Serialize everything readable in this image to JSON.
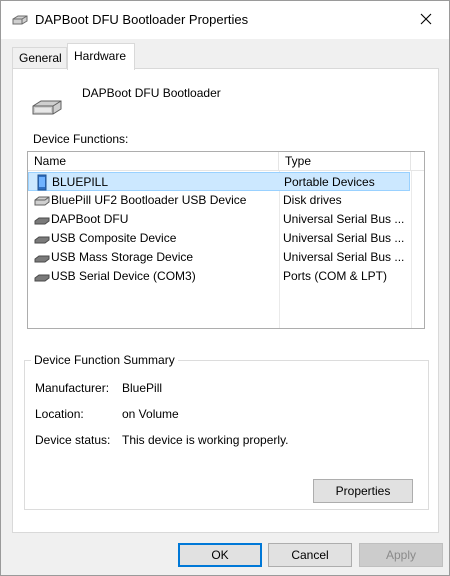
{
  "window": {
    "title": "DAPBoot DFU Bootloader Properties"
  },
  "tabs": [
    {
      "label": "General",
      "active": false
    },
    {
      "label": "Hardware",
      "active": true
    }
  ],
  "device": {
    "name": "DAPBoot DFU Bootloader"
  },
  "functions": {
    "label": "Device Functions:",
    "columns": {
      "name": "Name",
      "type": "Type"
    },
    "rows": [
      {
        "icon": "portable-device-icon",
        "name": "BLUEPILL",
        "type": "Portable Devices",
        "selected": true
      },
      {
        "icon": "disk-drive-icon",
        "name": "BluePill UF2 Bootloader USB Device",
        "type": "Disk drives",
        "selected": false
      },
      {
        "icon": "usb-device-icon",
        "name": "DAPBoot DFU",
        "type": "Universal Serial Bus ...",
        "selected": false
      },
      {
        "icon": "usb-device-icon",
        "name": "USB Composite Device",
        "type": "Universal Serial Bus ...",
        "selected": false
      },
      {
        "icon": "usb-device-icon",
        "name": "USB Mass Storage Device",
        "type": "Universal Serial Bus ...",
        "selected": false
      },
      {
        "icon": "usb-device-icon",
        "name": "USB Serial Device (COM3)",
        "type": "Ports (COM & LPT)",
        "selected": false
      }
    ]
  },
  "summary": {
    "title": "Device Function Summary",
    "manufacturer_label": "Manufacturer:",
    "manufacturer_value": "BluePill",
    "location_label": "Location:",
    "location_value": "on Volume",
    "status_label": "Device status:",
    "status_value": "This device is working properly.",
    "properties_button": "Properties"
  },
  "buttons": {
    "ok": "OK",
    "cancel": "Cancel",
    "apply": "Apply"
  },
  "colors": {
    "selection": "#cce8ff",
    "selection_border": "#99d1ff",
    "default_button_border": "#0078d7"
  }
}
